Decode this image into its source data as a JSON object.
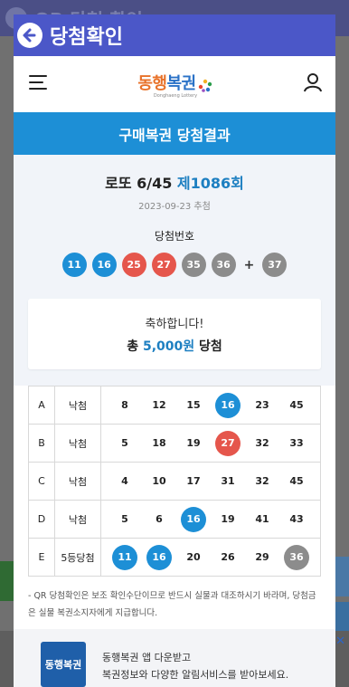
{
  "background": {
    "title": "QR 당첨 확인"
  },
  "header": {
    "title": "당첨확인"
  },
  "app": {
    "logo_text_1": "동행",
    "logo_text_2": "복권",
    "logo_sub": "Donghaeng Lottery"
  },
  "banner": {
    "title": "구매복권 당첨결과"
  },
  "draw": {
    "game": "로또 6/45 ",
    "round": "제1086회",
    "date": "2023-09-23 추첨",
    "winning_label": "당첨번호",
    "numbers": [
      "11",
      "16",
      "25",
      "27",
      "35",
      "36"
    ],
    "plus": "+",
    "bonus": "37"
  },
  "prize": {
    "congrats": "축하합니다!",
    "prefix": "총 ",
    "amount": "5,000원",
    "suffix": " 당첨"
  },
  "games": [
    {
      "label": "A",
      "result": "낙첨",
      "numbers": [
        "8",
        "12",
        "15",
        "16",
        "23",
        "45"
      ]
    },
    {
      "label": "B",
      "result": "낙첨",
      "numbers": [
        "5",
        "18",
        "19",
        "27",
        "32",
        "33"
      ]
    },
    {
      "label": "C",
      "result": "낙첨",
      "numbers": [
        "4",
        "10",
        "17",
        "31",
        "32",
        "45"
      ]
    },
    {
      "label": "D",
      "result": "낙첨",
      "numbers": [
        "5",
        "6",
        "16",
        "19",
        "41",
        "43"
      ]
    },
    {
      "label": "E",
      "result": "5등당첨",
      "numbers": [
        "11",
        "16",
        "20",
        "26",
        "29",
        "36"
      ]
    }
  ],
  "notice": "- QR 당첨확인은 보조 확인수단이므로 반드시 실물과 대조하시기 바라며, 당첨금은 실물 복권소지자에게 지급합니다.",
  "download": {
    "logo": "동행복권",
    "line1": "동행복권 앱 다운받고",
    "line2": "복권정보와 다양한 알림서비스를 받아보세요."
  },
  "colors": {
    "header": "#4b57c8",
    "banner": "#1d8fd6",
    "ball_blue": "#1d8fd6",
    "ball_red": "#e5564c",
    "ball_gray": "#8c8c8c"
  }
}
